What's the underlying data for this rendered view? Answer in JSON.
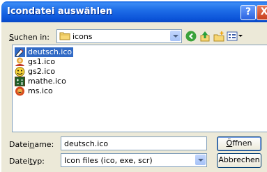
{
  "window": {
    "title": "Icondatei auswählen",
    "help_label": "?",
    "close_label": "X"
  },
  "lookin": {
    "label_pre": "",
    "label_key": "S",
    "label_post": "uchen in:",
    "value": "icons",
    "folder_icon": "folder-icon"
  },
  "toolbar": {
    "back_icon": "back-arrow-icon",
    "up_icon": "up-folder-icon",
    "new_folder_icon": "new-folder-icon",
    "views_icon": "views-menu-icon"
  },
  "files": [
    {
      "name": "deutsch.ico",
      "selected": true,
      "icon": "deutsch-icon"
    },
    {
      "name": "gs1.ico",
      "selected": false,
      "icon": "gs1-icon"
    },
    {
      "name": "gs2.ico",
      "selected": false,
      "icon": "gs2-icon"
    },
    {
      "name": "mathe.ico",
      "selected": false,
      "icon": "mathe-icon"
    },
    {
      "name": "ms.ico",
      "selected": false,
      "icon": "ms-icon"
    }
  ],
  "filename": {
    "label_pre": "Datei",
    "label_key": "n",
    "label_post": "ame:",
    "value": "deutsch.ico"
  },
  "filetype": {
    "label_pre": "Datei",
    "label_key": "t",
    "label_post": "yp:",
    "value": "Icon files (ico, exe, scr)"
  },
  "buttons": {
    "open_pre": "",
    "open_key": "Ö",
    "open_post": "ffnen",
    "cancel": "Abbrechen"
  },
  "colors": {
    "titlebar": "#0a5fe0",
    "selection": "#316ac5",
    "dialog_bg": "#ece9d8"
  }
}
